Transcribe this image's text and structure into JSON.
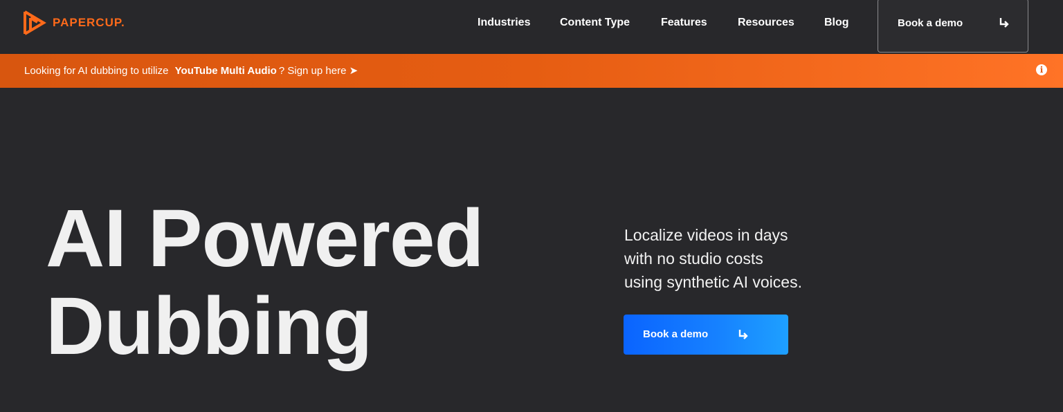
{
  "brand": {
    "name": "PAPERCUP.",
    "accent_color": "#ff6a1a"
  },
  "nav": {
    "items": [
      {
        "label": "Industries"
      },
      {
        "label": "Content Type"
      },
      {
        "label": "Features"
      },
      {
        "label": "Resources"
      },
      {
        "label": "Blog"
      }
    ],
    "cta": {
      "label": "Book a demo",
      "icon": "arrow-turn-down-right-icon"
    }
  },
  "banner": {
    "prefix": "Looking for AI dubbing to utilize",
    "link_text": "YouTube Multi Audio",
    "suffix": "? Sign up here ➤",
    "info_icon": "info-icon",
    "info_glyph": "i",
    "background_color": "#e65d12"
  },
  "hero": {
    "title_line1": "AI Powered",
    "title_line2": "Dubbing",
    "subtitle_line1": "Localize videos in days",
    "subtitle_line2": "with no studio costs",
    "subtitle_line3": "using synthetic AI voices.",
    "cta": {
      "label": "Book a demo",
      "icon": "arrow-turn-down-right-icon",
      "color": "#0a64ff"
    }
  }
}
